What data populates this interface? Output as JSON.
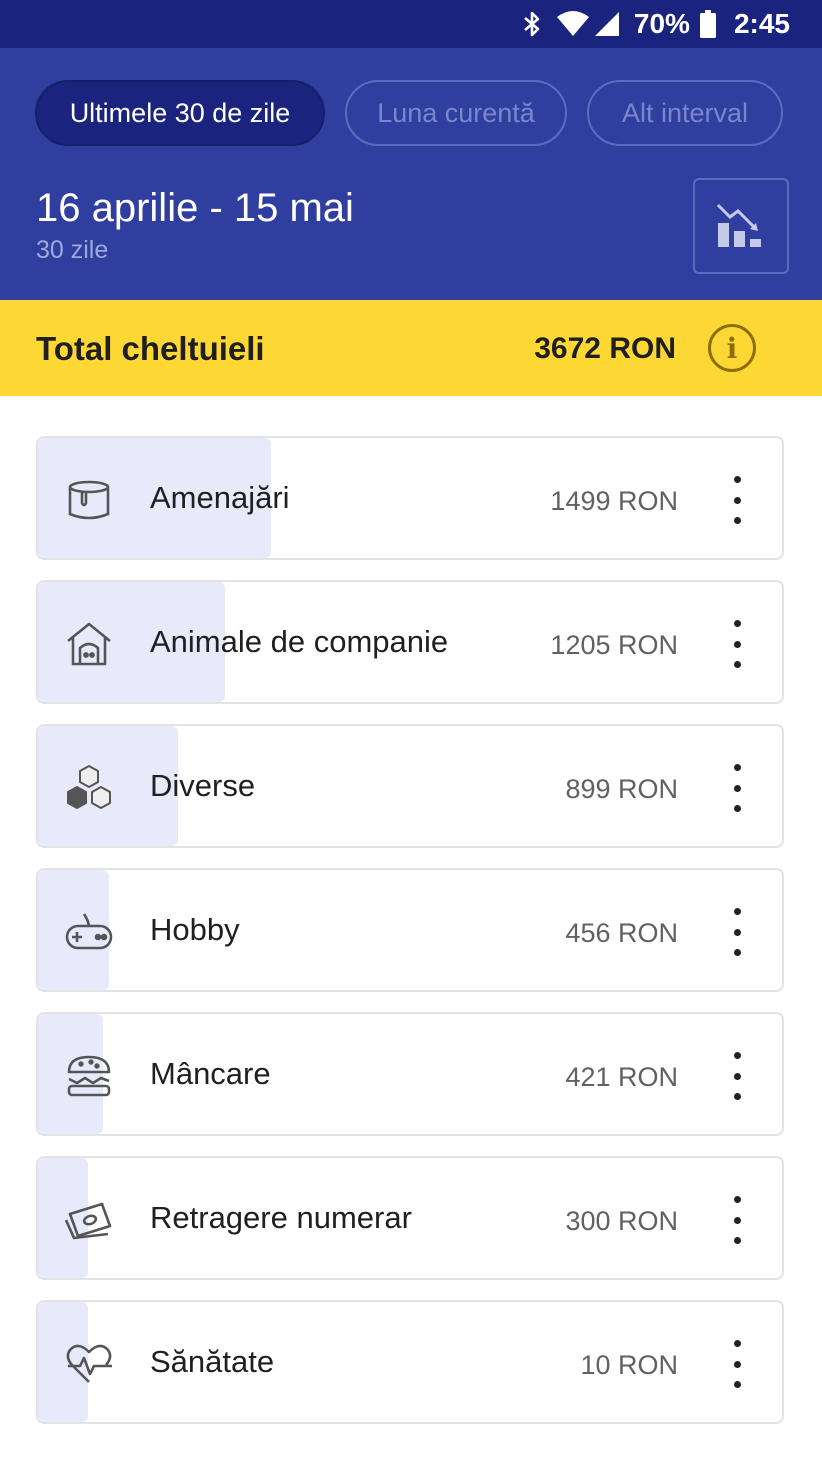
{
  "status_bar": {
    "battery": "70%",
    "time": "2:45"
  },
  "filters": [
    {
      "label": "Ultimele 30 de zile",
      "active": true
    },
    {
      "label": "Luna curentă",
      "active": false
    },
    {
      "label": "Alt interval",
      "active": false
    }
  ],
  "period": {
    "range": "16 aprilie - 15 mai",
    "days": "30 zile"
  },
  "total": {
    "label": "Total cheltuieli",
    "value": "3672 RON",
    "info_icon": "i"
  },
  "categories": [
    {
      "name": "Amenajări",
      "amount": "1499 RON",
      "value": 1499,
      "icon": "paint-bucket-icon"
    },
    {
      "name": "Animale de companie",
      "amount": "1205 RON",
      "value": 1205,
      "icon": "pet-house-icon"
    },
    {
      "name": "Diverse",
      "amount": "899 RON",
      "value": 899,
      "icon": "cubes-icon"
    },
    {
      "name": "Hobby",
      "amount": "456 RON",
      "value": 456,
      "icon": "gamepad-icon"
    },
    {
      "name": "Mâncare",
      "amount": "421 RON",
      "value": 421,
      "icon": "burger-icon"
    },
    {
      "name": "Retragere numerar",
      "amount": "300 RON",
      "value": 300,
      "icon": "cash-icon"
    },
    {
      "name": "Sănătate",
      "amount": "10 RON",
      "value": 10,
      "icon": "heart-pulse-icon"
    }
  ],
  "colors": {
    "header": "#303f9f",
    "status_bar": "#1a237e",
    "total_bar": "#fdd835",
    "bar_fill": "#e8eafc"
  }
}
